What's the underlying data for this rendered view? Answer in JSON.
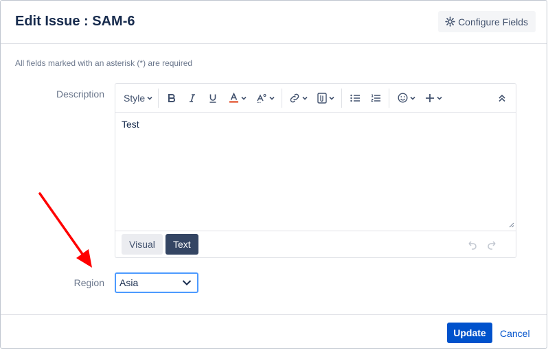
{
  "dialog": {
    "title": "Edit Issue : SAM-6",
    "configure_label": "Configure Fields",
    "required_note": "All fields marked with an asterisk (*) are required"
  },
  "description": {
    "label": "Description",
    "toolbar": {
      "style_label": "Style",
      "icons": [
        "bold-icon",
        "italic-icon",
        "underline-icon",
        "text-color-icon",
        "text-effects-icon",
        "link-icon",
        "attachment-icon",
        "bullet-list-icon",
        "numbered-list-icon",
        "emoji-icon",
        "insert-plus-icon",
        "collapse-icon"
      ]
    },
    "value": "Test",
    "modes": {
      "visual": "Visual",
      "text": "Text",
      "active": "Text"
    }
  },
  "region": {
    "label": "Region",
    "selected": "Asia"
  },
  "footer": {
    "update_label": "Update",
    "cancel_label": "Cancel"
  },
  "colors": {
    "primary": "#0052cc",
    "focus": "#4c9aff",
    "annotation_arrow": "#ff0000",
    "text_color_underline": "#de350b"
  }
}
